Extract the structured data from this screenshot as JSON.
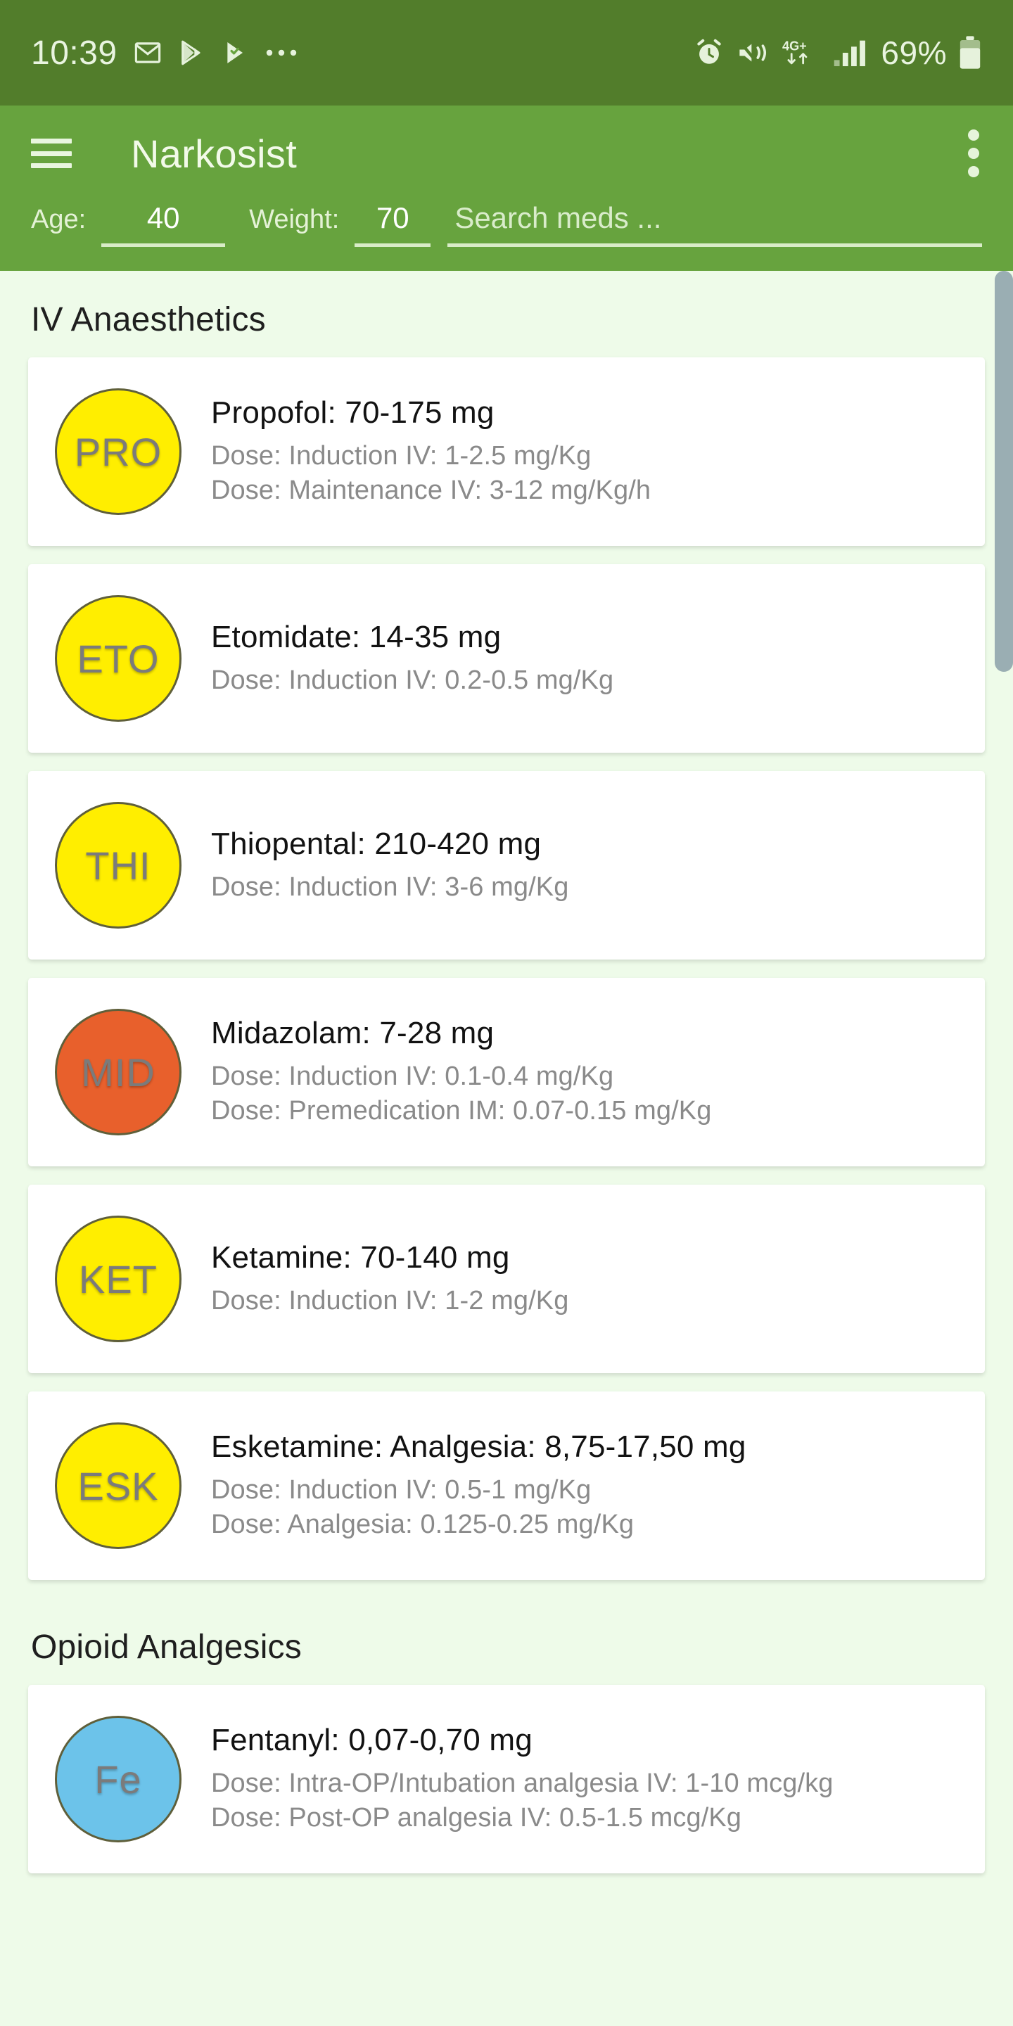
{
  "status_bar": {
    "time": "10:39",
    "left_icons": [
      "gmail-icon",
      "play-store-icon",
      "play-protect-icon",
      "more-notifications-icon"
    ],
    "right_icons": [
      "alarm-icon",
      "vibrate-mute-icon",
      "network-4gplus-icon",
      "signal-bars-icon"
    ],
    "battery_percent": "69%",
    "battery_icon": "battery-icon",
    "bg_color": "#527d2b"
  },
  "app_bar": {
    "menu_icon": "hamburger-icon",
    "title": "Narkosist",
    "overflow_icon": "overflow-menu-icon",
    "bg_color": "#67a33e"
  },
  "inputs": {
    "age_label": "Age:",
    "age_value": "40",
    "weight_label": "Weight:",
    "weight_value": "70",
    "search_placeholder": "Search meds ...",
    "search_value": ""
  },
  "content": {
    "bg_color": "#eefbe9",
    "sections": [
      {
        "title": "IV Anaesthetics",
        "cards": [
          {
            "badge": "PRO",
            "badge_color": "#ffee00",
            "title": "Propofol: 70-175 mg",
            "doses": [
              "Dose: Induction IV: 1-2.5 mg/Kg",
              "Dose: Maintenance IV: 3-12 mg/Kg/h"
            ]
          },
          {
            "badge": "ETO",
            "badge_color": "#ffee00",
            "title": "Etomidate: 14-35 mg",
            "doses": [
              "Dose: Induction IV: 0.2-0.5 mg/Kg"
            ]
          },
          {
            "badge": "THI",
            "badge_color": "#ffee00",
            "title": "Thiopental: 210-420 mg",
            "doses": [
              "Dose: Induction IV: 3-6 mg/Kg"
            ]
          },
          {
            "badge": "MID",
            "badge_color": "#e8602c",
            "title": "Midazolam: 7-28 mg",
            "doses": [
              "Dose: Induction IV: 0.1-0.4 mg/Kg",
              "Dose: Premedication IM: 0.07-0.15 mg/Kg"
            ]
          },
          {
            "badge": "KET",
            "badge_color": "#ffee00",
            "title": "Ketamine: 70-140 mg",
            "doses": [
              "Dose: Induction IV: 1-2 mg/Kg"
            ]
          },
          {
            "badge": "ESK",
            "badge_color": "#ffee00",
            "title": "Esketamine: Analgesia: 8,75-17,50 mg",
            "doses": [
              "Dose: Induction IV: 0.5-1 mg/Kg",
              "Dose: Analgesia: 0.125-0.25 mg/Kg"
            ]
          }
        ]
      },
      {
        "title": "Opioid Analgesics",
        "cards": [
          {
            "badge": "Fe",
            "badge_color": "#6cc3ea",
            "title": "Fentanyl: 0,07-0,70 mg",
            "doses": [
              "Dose: Intra-OP/Intubation analgesia IV: 1-10 mcg/kg",
              "Dose: Post-OP analgesia IV: 0.5-1.5 mcg/Kg"
            ]
          }
        ]
      }
    ]
  },
  "scrollbar": {
    "thumb_color": "#9aaeb3"
  }
}
